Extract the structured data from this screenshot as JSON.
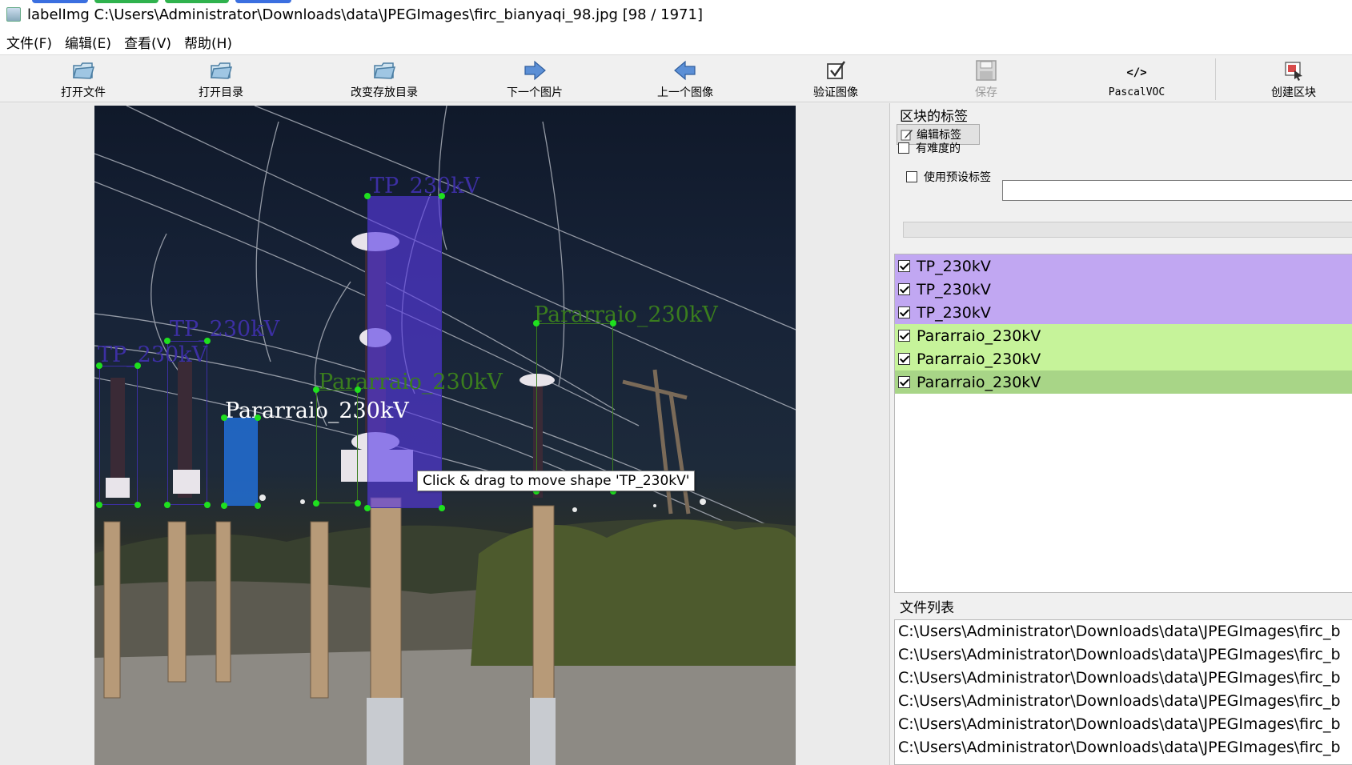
{
  "window": {
    "title": "labelImg C:\\Users\\Administrator\\Downloads\\data\\JPEGImages\\firc_bianyaqi_98.jpg [98 / 1971]"
  },
  "menu": [
    "文件(F)",
    "编辑(E)",
    "查看(V)",
    "帮助(H)"
  ],
  "toolbar": {
    "open_file": "打开文件",
    "open_dir": "打开目录",
    "change_save_dir": "改变存放目录",
    "next_image": "下一个图片",
    "prev_image": "上一个图像",
    "verify_image": "验证图像",
    "save": "保存",
    "format": "PascalVOC",
    "create_box": "创建区块"
  },
  "box_labels_panel": {
    "title": "区块的标签",
    "edit_label": "编辑标签",
    "difficult": "有难度的",
    "use_default_label": "使用预设标签",
    "default_label_value": ""
  },
  "label_list": [
    {
      "text": "TP_230kV",
      "checked": true,
      "color": "#c1a7f2"
    },
    {
      "text": "TP_230kV",
      "checked": true,
      "color": "#c1a7f2"
    },
    {
      "text": "TP_230kV",
      "checked": true,
      "color": "#c1a7f2"
    },
    {
      "text": "Pararraio_230kV",
      "checked": true,
      "color": "#c6f39a"
    },
    {
      "text": "Pararraio_230kV",
      "checked": true,
      "color": "#c6f39a"
    },
    {
      "text": "Pararraio_230kV",
      "checked": true,
      "color": "#a8d587"
    }
  ],
  "file_list_panel": {
    "title": "文件列表",
    "files": [
      "C:\\Users\\Administrator\\Downloads\\data\\JPEGImages\\firc_b",
      "C:\\Users\\Administrator\\Downloads\\data\\JPEGImages\\firc_b",
      "C:\\Users\\Administrator\\Downloads\\data\\JPEGImages\\firc_b",
      "C:\\Users\\Administrator\\Downloads\\data\\JPEGImages\\firc_b",
      "C:\\Users\\Administrator\\Downloads\\data\\JPEGImages\\firc_b",
      "C:\\Users\\Administrator\\Downloads\\data\\JPEGImages\\firc_b"
    ]
  },
  "canvas": {
    "tooltip": "Click & drag to move shape 'TP_230kV'",
    "annotations": {
      "tp_left": "TP_230kV",
      "tp_mid_left": "TP_230kV",
      "tp_center": "TP_230kV",
      "pr_small_left": "Pararraio_230kV",
      "pr_mid": "Pararraio_230kV",
      "pr_right": "Pararraio_230kV"
    },
    "colors": {
      "tp": "#3c2fa3",
      "pararraio": "#3a7d1e",
      "handle": "#1fe01f"
    }
  }
}
